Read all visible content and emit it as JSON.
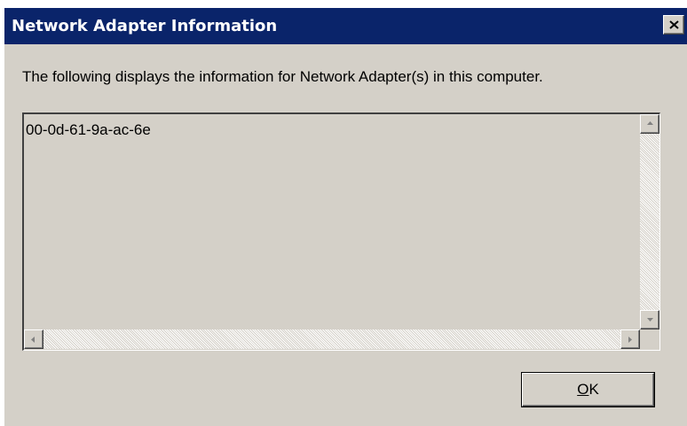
{
  "window": {
    "title": "Network Adapter Information",
    "description": "The following displays the information for Network Adapter(s) in this computer."
  },
  "adapter_list": {
    "items": [
      "00-0d-61-9a-ac-6e"
    ]
  },
  "buttons": {
    "ok_mnemonic": "O",
    "ok_rest": "K"
  },
  "icons": {
    "close": "close-icon",
    "scroll_up": "scroll-up-arrow-icon",
    "scroll_down": "scroll-down-arrow-icon",
    "scroll_left": "scroll-left-arrow-icon",
    "scroll_right": "scroll-right-arrow-icon"
  },
  "colors": {
    "titlebar": "#0a246a",
    "title_text": "#ffffff",
    "dialog_face": "#d4d0c8"
  }
}
